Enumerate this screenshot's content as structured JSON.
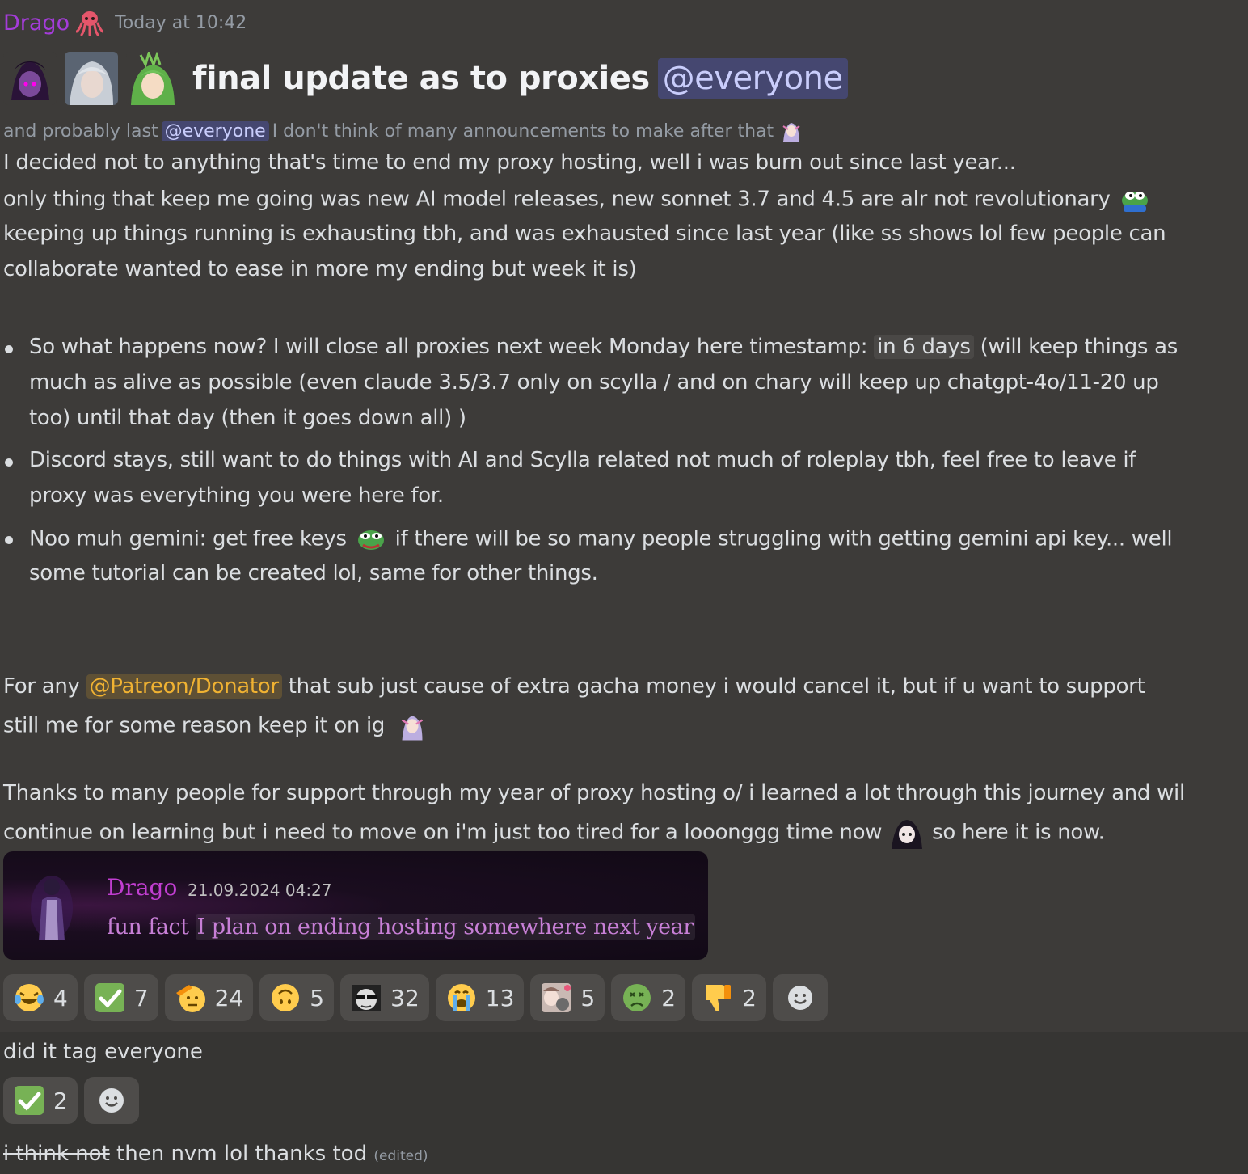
{
  "message": {
    "author": "Drago",
    "author_emoji": "octopus-icon",
    "timestamp": "Today at 10:42",
    "title": "final update as to proxies",
    "title_mention": "@everyone",
    "sub_prefix": "and probably last",
    "sub_mention": "@everyone",
    "sub_suffix": "I don't think of many announcements to make after that",
    "lines": [
      "I decided not to anything that's time to end my proxy hosting, well i was burn out since last year...",
      "only thing that keep me going was new AI model releases, new sonnet 3.7 and 4.5 are alr not revolutionary",
      "keeping up things running is exhausting tbh, and was exhausted since last year (like ss shows lol few people can",
      "collaborate wanted to ease in more my ending but week it is)"
    ],
    "bullet1": {
      "pre": "So what happens now? I will close all proxies next week Monday here timestamp:",
      "timestamp": "in 6 days",
      "post": "(will keep things as",
      "line2": "much as alive as possible (even claude 3.5/3.7 only on scylla / and on chary will keep up chatgpt-4o/11-20 up",
      "line3": "too) until that day (then it goes down all) )"
    },
    "bullet2": {
      "line1": "Discord stays, still want to do things with AI and Scylla related not much of roleplay tbh, feel free to leave if",
      "line2": "proxy was everything you were here for."
    },
    "bullet3": {
      "pre": "Noo muh gemini: get free keys",
      "post": "if there will be so many people struggling with getting gemini api key... well",
      "line2": "some tutorial can be created lol, same for other things."
    },
    "patreon": {
      "pre": "For any",
      "role": "@Patreon/Donator",
      "post": "that sub just cause of extra gacha money i would cancel it, but if u want to support",
      "line2": "still me for some reason keep it on ig"
    },
    "thanks": {
      "line1": "Thanks to many people for support through my year of proxy hosting o/ i learned a lot through this journey and wil",
      "line2_pre": "continue on learning but  i need to move on i'm just too tired for a looonggg time now",
      "line2_post": "so here it is now."
    },
    "embed": {
      "author": "Drago",
      "date": "21.09.2024 04:27",
      "text_pre": "fun fact ",
      "text_hl": "I plan on ending hosting somewhere next year"
    },
    "reactions": [
      {
        "icon": "laughing-tears-icon",
        "count": "4"
      },
      {
        "icon": "check-mark-icon",
        "count": "7"
      },
      {
        "icon": "saluting-face-icon",
        "count": "24"
      },
      {
        "icon": "upside-down-face-icon",
        "count": "5"
      },
      {
        "icon": "sunglasses-meme-icon",
        "count": "32"
      },
      {
        "icon": "crying-face-icon",
        "count": "13"
      },
      {
        "icon": "anime-cat-icon",
        "count": "5"
      },
      {
        "icon": "nauseated-face-icon",
        "count": "2"
      },
      {
        "icon": "thumbs-down-icon",
        "count": "2"
      }
    ]
  },
  "reply": {
    "text": "did it tag everyone",
    "reaction": {
      "icon": "check-mark-icon",
      "count": "2"
    },
    "followup_struck": "i think not",
    "followup": " then nvm lol thanks tod",
    "edited": "(edited)"
  },
  "colors": {
    "background": "#3d3b39",
    "author": "#a43cd9",
    "mention_bg": "#5865f24d",
    "role": "#f0b232"
  }
}
